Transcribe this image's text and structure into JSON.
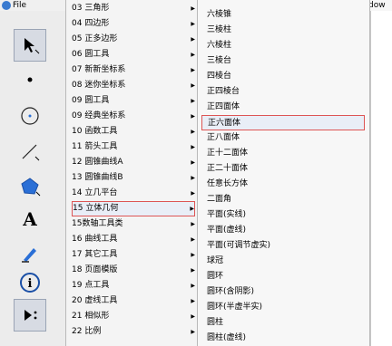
{
  "menubar": {
    "file_label": "File",
    "window_label": "dow"
  },
  "toolbar": {
    "tools": [
      {
        "name": "arrow-select-tool-icon"
      },
      {
        "name": "point-tool-icon"
      },
      {
        "name": "compass-tool-icon"
      },
      {
        "name": "line-tool-icon"
      },
      {
        "name": "polygon-tool-icon"
      },
      {
        "name": "text-tool-icon"
      },
      {
        "name": "marker-tool-icon"
      },
      {
        "name": "info-tool-icon"
      },
      {
        "name": "custom-tool-icon"
      }
    ],
    "text_tool_glyph": "A",
    "info_tool_glyph": "i"
  },
  "submenu1": {
    "items": [
      {
        "label": "03 三角形"
      },
      {
        "label": "04 四边形"
      },
      {
        "label": "05 正多边形"
      },
      {
        "label": "06 圆工具"
      },
      {
        "label": "07 新新坐标系"
      },
      {
        "label": "08 迷你坐标系"
      },
      {
        "label": "09 圆工具"
      },
      {
        "label": "09 经典坐标系"
      },
      {
        "label": "10 函数工具"
      },
      {
        "label": "11 箭头工具"
      },
      {
        "label": "12 圆锥曲线A"
      },
      {
        "label": "13 圆锥曲线B"
      },
      {
        "label": "14 立几平台"
      },
      {
        "label": "15 立体几何"
      },
      {
        "label": "15数轴工具类"
      },
      {
        "label": "16 曲线工具"
      },
      {
        "label": "17 其它工具"
      },
      {
        "label": "18 页面模版"
      },
      {
        "label": "19 点工具"
      },
      {
        "label": "20 虚线工具"
      },
      {
        "label": "21 相似形"
      },
      {
        "label": "22 比例"
      }
    ],
    "arrow": "▶"
  },
  "submenu2": {
    "items": [
      {
        "label": "六棱锥"
      },
      {
        "label": "三棱柱"
      },
      {
        "label": "六棱柱"
      },
      {
        "label": "三棱台"
      },
      {
        "label": "四棱台"
      },
      {
        "label": "正四棱台"
      },
      {
        "label": "正四面体"
      },
      {
        "label": "正六面体"
      },
      {
        "label": "正八面体"
      },
      {
        "label": "正十二面体"
      },
      {
        "label": "正二十面体"
      },
      {
        "label": "任意长方体"
      },
      {
        "label": "二面角"
      },
      {
        "label": "平面(实线)"
      },
      {
        "label": "平面(虚线)"
      },
      {
        "label": "平面(可调节虚实)"
      },
      {
        "label": "球冠"
      },
      {
        "label": "圆环"
      },
      {
        "label": "圆环(含阴影)"
      },
      {
        "label": "圆环(半虚半实)"
      },
      {
        "label": "圆柱"
      },
      {
        "label": "圆柱(虚线)"
      }
    ]
  },
  "colors": {
    "accent_red": "#dd5555",
    "tool_blue": "#2a6fd6"
  }
}
